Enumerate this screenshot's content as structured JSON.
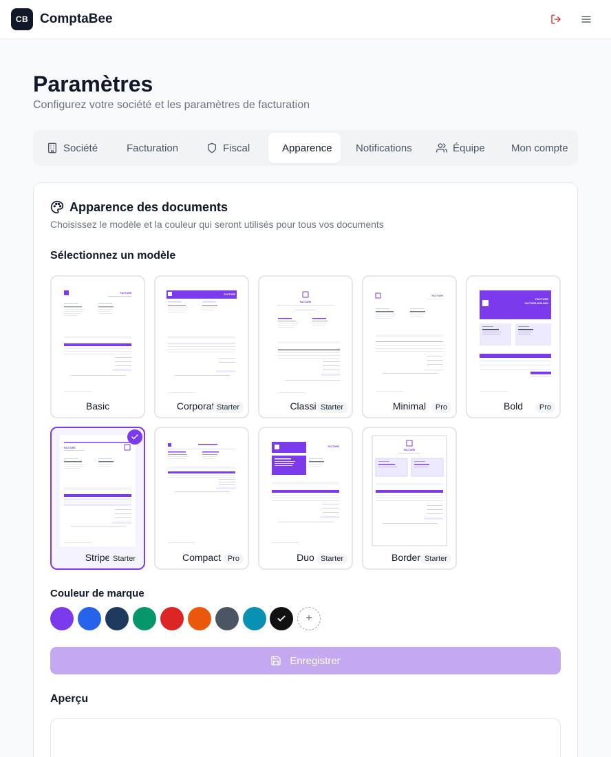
{
  "app": {
    "logo_text": "CB",
    "name": "ComptaBee"
  },
  "header": {
    "logout_icon": "logout-icon",
    "menu_icon": "hamburger-menu-icon"
  },
  "page": {
    "title": "Paramètres",
    "subtitle": "Configurez votre société et les paramètres de facturation"
  },
  "tabs": [
    {
      "label": "Société",
      "icon": "building-icon"
    },
    {
      "label": "Facturation",
      "icon": ""
    },
    {
      "label": "Fiscal",
      "icon": "shield-icon"
    },
    {
      "label": "Apparence",
      "icon": "",
      "active": true
    },
    {
      "label": "Notifications",
      "icon": ""
    },
    {
      "label": "Équipe",
      "icon": "users-icon"
    },
    {
      "label": "Mon compte",
      "icon": ""
    }
  ],
  "card": {
    "title": "Apparence des documents",
    "icon": "palette-icon",
    "description": "Choisissez le modèle et la couleur qui seront utilisés pour tous vos documents"
  },
  "templates_label": "Sélectionnez un modèle",
  "templates": [
    {
      "name": "Basic",
      "badge": ""
    },
    {
      "name": "Corporate",
      "badge": "Starter"
    },
    {
      "name": "Classic",
      "badge": "Starter"
    },
    {
      "name": "Minimal",
      "badge": "Pro"
    },
    {
      "name": "Bold",
      "badge": "Pro"
    },
    {
      "name": "Stripe",
      "badge": "Starter",
      "selected": true
    },
    {
      "name": "Compact",
      "badge": "Pro"
    },
    {
      "name": "Duo",
      "badge": "Starter"
    },
    {
      "name": "Border",
      "badge": "Starter"
    }
  ],
  "brand_color_label": "Couleur de marque",
  "brand_colors": [
    {
      "name": "violet",
      "hex": "#7c3aed"
    },
    {
      "name": "blue",
      "hex": "#2563eb"
    },
    {
      "name": "navy",
      "hex": "#1e3a5f"
    },
    {
      "name": "green",
      "hex": "#059669"
    },
    {
      "name": "red",
      "hex": "#dc2626"
    },
    {
      "name": "orange",
      "hex": "#ea580c"
    },
    {
      "name": "slate",
      "hex": "#4b5563"
    },
    {
      "name": "cyan",
      "hex": "#0891b2"
    },
    {
      "name": "black",
      "hex": "#111111",
      "selected": true
    }
  ],
  "custom_color_symbol": "+",
  "save_button": {
    "label": "Enregistrer",
    "icon": "save-icon"
  },
  "preview_label": "Aperçu",
  "thumbnail_texts": {
    "facture": "FACTURE",
    "facture_number": "FACTURE-2026-0001"
  }
}
